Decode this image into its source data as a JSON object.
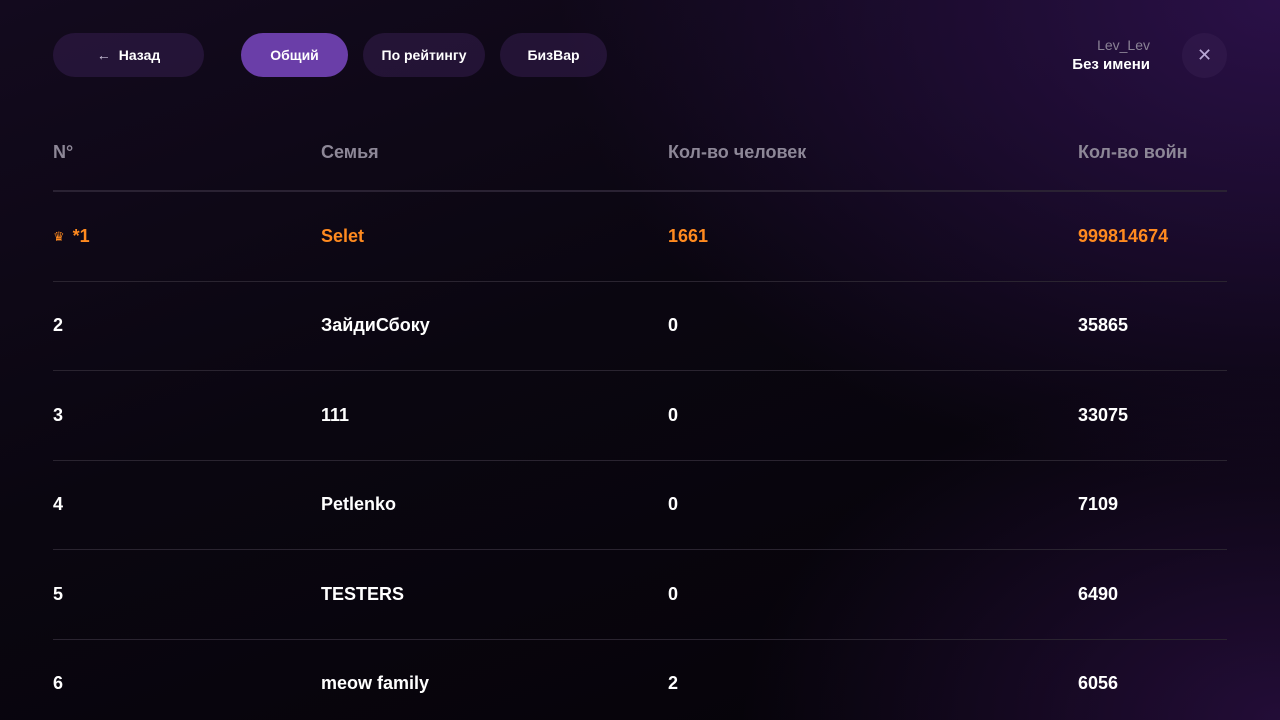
{
  "nav": {
    "back_label": "Назад",
    "back_arrow": "←"
  },
  "tabs": [
    {
      "label": "Общий",
      "active": true
    },
    {
      "label": "По рейтингу",
      "active": false
    },
    {
      "label": "БизВар",
      "active": false
    }
  ],
  "user": {
    "nickname": "Lev_Lev",
    "name": "Без имени"
  },
  "close_icon": "✕",
  "table": {
    "headers": [
      "N°",
      "Семья",
      "Кол-во человек",
      "Кол-во войн"
    ],
    "rows": [
      {
        "rank": "*1",
        "family": "Selet",
        "members": "1661",
        "wars": "999814674",
        "highlight": true,
        "icon": "crown-icon"
      },
      {
        "rank": "2",
        "family": "ЗайдиСбоку",
        "members": "0",
        "wars": "35865"
      },
      {
        "rank": "3",
        "family": "111",
        "members": "0",
        "wars": "33075"
      },
      {
        "rank": "4",
        "family": "Petlenko",
        "members": "0",
        "wars": "7109"
      },
      {
        "rank": "5",
        "family": "TESTERS",
        "members": "0",
        "wars": "6490"
      },
      {
        "rank": "6",
        "family": "meow family",
        "members": "2",
        "wars": "6056"
      }
    ]
  },
  "colors": {
    "accent": "#6a3ea8",
    "highlight": "#ff8a1f",
    "header_text": "#8d8797"
  }
}
